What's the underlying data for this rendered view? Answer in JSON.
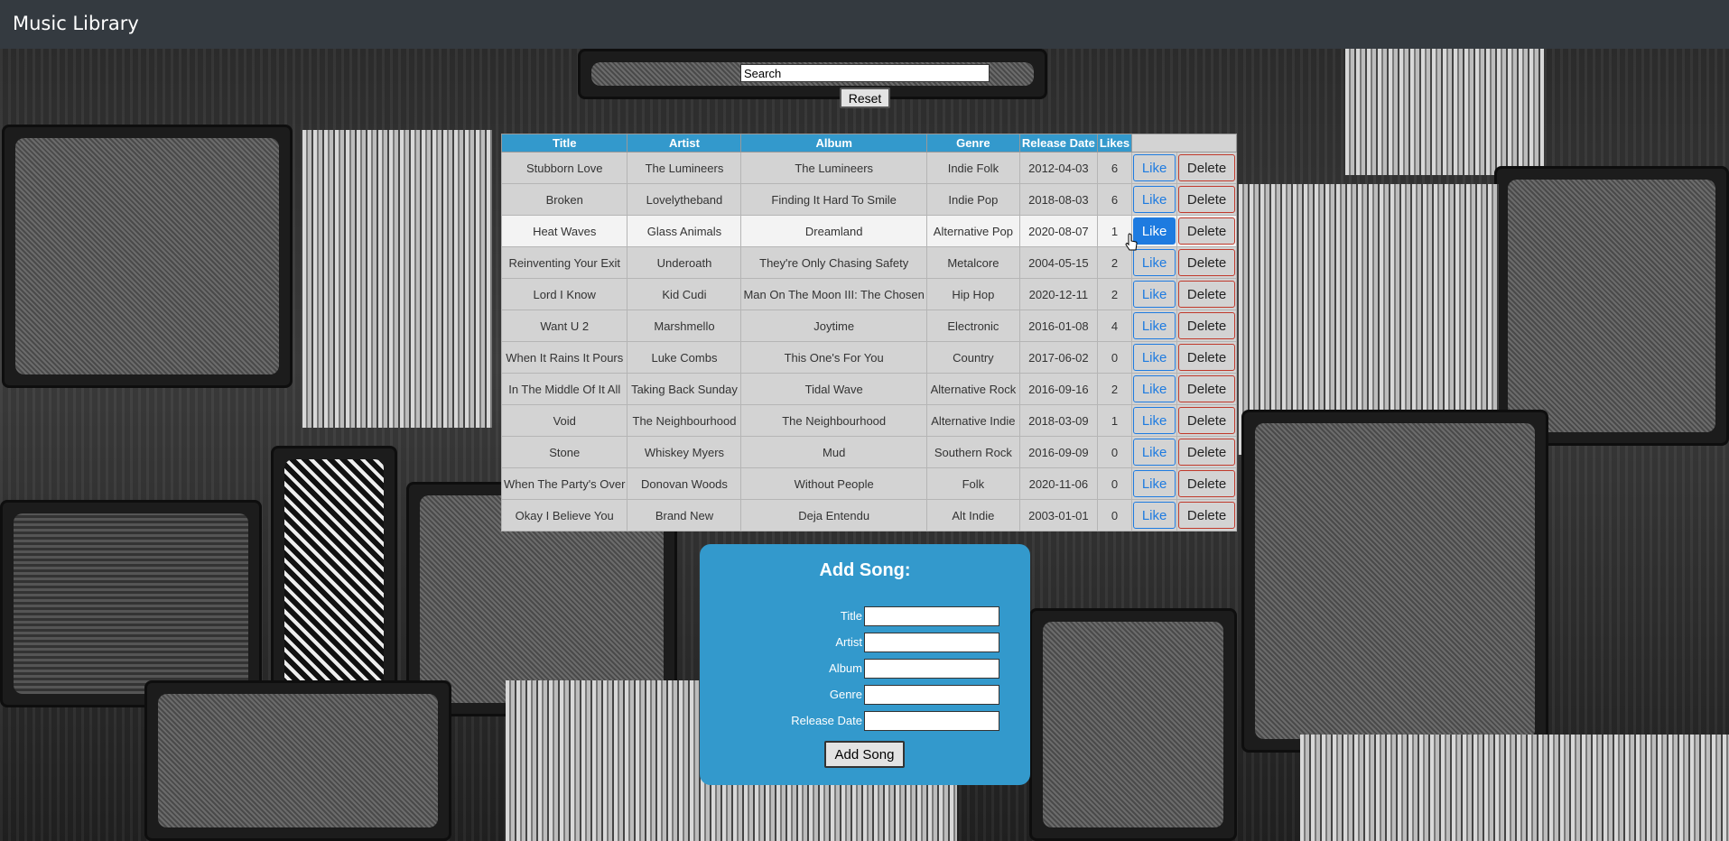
{
  "app": {
    "title": "Music Library"
  },
  "search": {
    "placeholder": "Search",
    "value": "Search",
    "reset_label": "Reset"
  },
  "table": {
    "headers": [
      "Title",
      "Artist",
      "Album",
      "Genre",
      "Release Date",
      "Likes",
      ""
    ],
    "like_label": "Like",
    "delete_label": "Delete",
    "rows": [
      {
        "title": "Stubborn Love",
        "artist": "The Lumineers",
        "album": "The Lumineers",
        "genre": "Indie Folk",
        "release_date": "2012-04-03",
        "likes": "6"
      },
      {
        "title": "Broken",
        "artist": "Lovelytheband",
        "album": "Finding It Hard To Smile",
        "genre": "Indie Pop",
        "release_date": "2018-08-03",
        "likes": "6"
      },
      {
        "title": "Heat Waves",
        "artist": "Glass Animals",
        "album": "Dreamland",
        "genre": "Alternative Pop",
        "release_date": "2020-08-07",
        "likes": "1"
      },
      {
        "title": "Reinventing Your Exit",
        "artist": "Underoath",
        "album": "They're Only Chasing Safety",
        "genre": "Metalcore",
        "release_date": "2004-05-15",
        "likes": "2"
      },
      {
        "title": "Lord I Know",
        "artist": "Kid Cudi",
        "album": "Man On The Moon III: The Chosen",
        "genre": "Hip Hop",
        "release_date": "2020-12-11",
        "likes": "2"
      },
      {
        "title": "Want U 2",
        "artist": "Marshmello",
        "album": "Joytime",
        "genre": "Electronic",
        "release_date": "2016-01-08",
        "likes": "4"
      },
      {
        "title": "When It Rains It Pours",
        "artist": "Luke Combs",
        "album": "This One's For You",
        "genre": "Country",
        "release_date": "2017-06-02",
        "likes": "0"
      },
      {
        "title": "In The Middle Of It All",
        "artist": "Taking Back Sunday",
        "album": "Tidal Wave",
        "genre": "Alternative Rock",
        "release_date": "2016-09-16",
        "likes": "2"
      },
      {
        "title": "Void",
        "artist": "The Neighbourhood",
        "album": "The Neighbourhood",
        "genre": "Alternative Indie",
        "release_date": "2018-03-09",
        "likes": "1"
      },
      {
        "title": "Stone",
        "artist": "Whiskey Myers",
        "album": "Mud",
        "genre": "Southern Rock",
        "release_date": "2016-09-09",
        "likes": "0"
      },
      {
        "title": "When The Party's Over",
        "artist": "Donovan Woods",
        "album": "Without People",
        "genre": "Folk",
        "release_date": "2020-11-06",
        "likes": "0"
      },
      {
        "title": "Okay I Believe You",
        "artist": "Brand New",
        "album": "Deja Entendu",
        "genre": "Alt Indie",
        "release_date": "2003-01-01",
        "likes": "0"
      }
    ]
  },
  "add_song": {
    "title": "Add Song:",
    "fields": [
      {
        "label": "Title",
        "value": ""
      },
      {
        "label": "Artist",
        "value": ""
      },
      {
        "label": "Album",
        "value": ""
      },
      {
        "label": "Genre",
        "value": ""
      },
      {
        "label": "Release Date",
        "value": ""
      }
    ],
    "submit_label": "Add Song"
  },
  "colors": {
    "navbar": "#343a40",
    "accent": "#3399cc",
    "like": "#1e7be0",
    "delete_border": "#c0392b"
  },
  "icons": {
    "cursor": "hand-pointer-icon"
  }
}
